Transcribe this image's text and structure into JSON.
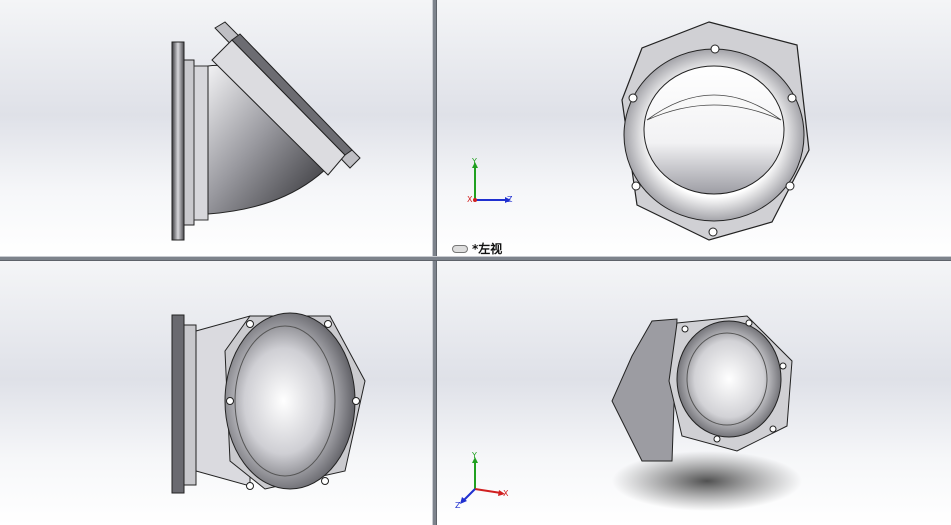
{
  "viewports": {
    "top_left": {
      "name": "left-side-view"
    },
    "top_right": {
      "name": "front-view",
      "label": "*左视",
      "triad": {
        "x": "X",
        "y": "Y",
        "z": "Z"
      }
    },
    "bottom_left": {
      "name": "perspective-view-1"
    },
    "bottom_right": {
      "name": "isometric-view",
      "triad": {
        "x": "X",
        "y": "Y",
        "z": "Z"
      }
    }
  },
  "colors": {
    "background_top": "#f4f5f7",
    "background_bottom": "#ffffff",
    "splitter": "#7d838c",
    "x_axis": "#d02020",
    "y_axis": "#20a020",
    "z_axis": "#2030d0"
  }
}
